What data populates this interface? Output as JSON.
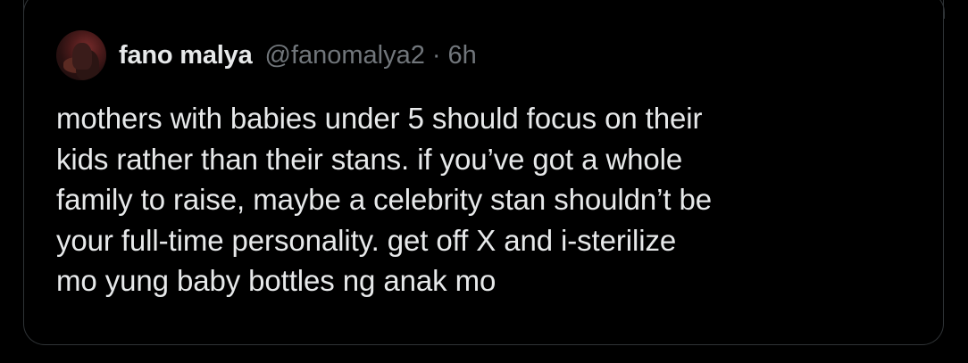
{
  "tweet": {
    "author_name": "fano malya",
    "author_handle": "@fanomalya2",
    "separator": "·",
    "timestamp": "6h",
    "text": "mothers with babies under 5 should focus on their\nkids rather than their stans. if you’ve got a whole\nfamily to raise, maybe a celebrity stan shouldn’t be\nyour full-time personality. get off X and i-sterilize\nmo yung baby bottles ng anak mo"
  },
  "colors": {
    "background": "#000000",
    "border": "#2f3336",
    "primary_text": "#e7e9ea",
    "secondary_text": "#71767b"
  }
}
